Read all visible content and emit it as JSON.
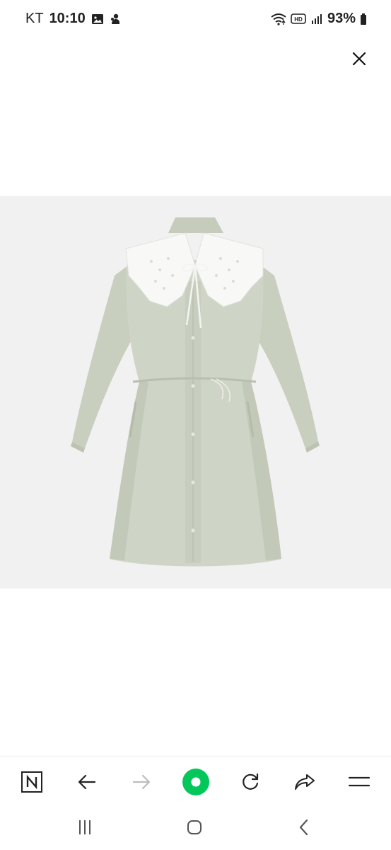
{
  "status_bar": {
    "carrier": "KT",
    "time": "10:10",
    "network_badge": "HD",
    "battery": "93%",
    "icons": [
      "gallery-icon",
      "notification-icon",
      "wifi-icon",
      "hd-voice-icon",
      "signal-icon",
      "battery-icon"
    ]
  },
  "viewer": {
    "close_icon": "close-icon",
    "image_subject": "garment-image",
    "background_color": "#f1f1f1"
  },
  "browser_toolbar": {
    "buttons": [
      "naver-home-icon",
      "back-arrow-icon",
      "forward-arrow-icon",
      "green-dot-icon",
      "refresh-icon",
      "share-icon",
      "menu-icon"
    ],
    "accent_color": "#03c75a"
  },
  "system_nav": {
    "buttons": [
      "recent-apps-icon",
      "home-icon",
      "back-icon"
    ]
  }
}
